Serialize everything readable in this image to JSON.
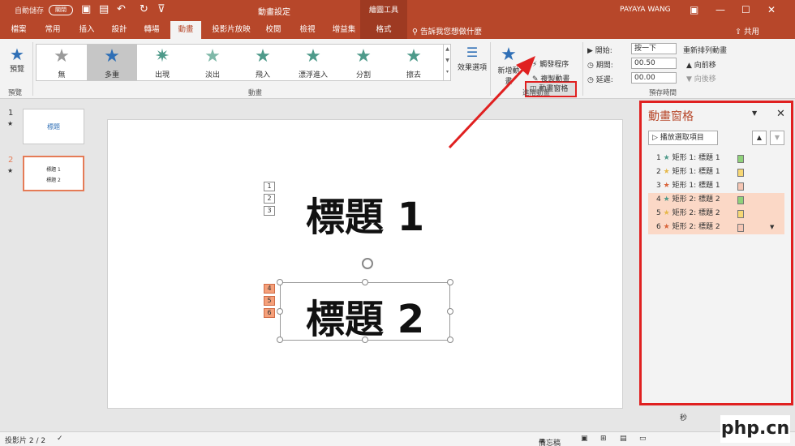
{
  "titlebar": {
    "autosave": "自動儲存",
    "autosave_state": "關閉",
    "doc_title": "動畫設定",
    "context_tools": "繪圖工具",
    "user": "PAYAYA WANG"
  },
  "tabs": [
    {
      "label": "檔案"
    },
    {
      "label": "常用"
    },
    {
      "label": "插入"
    },
    {
      "label": "設計"
    },
    {
      "label": "轉場"
    },
    {
      "label": "動畫"
    },
    {
      "label": "投影片放映"
    },
    {
      "label": "校閱"
    },
    {
      "label": "檢視"
    },
    {
      "label": "增益集"
    },
    {
      "label": "格式"
    }
  ],
  "tell_me": "告訴我您想做什麼",
  "share": "共用",
  "ribbon": {
    "preview": "預覽",
    "preview_group": "預覽",
    "animations": [
      {
        "label": "無",
        "color": "#9a9a9a"
      },
      {
        "label": "多重",
        "color": "#2f6fb6"
      },
      {
        "label": "出現",
        "color": "#4e9a8a"
      },
      {
        "label": "淡出",
        "color": "#4e9a8a"
      },
      {
        "label": "飛入",
        "color": "#4e9a8a"
      },
      {
        "label": "漂浮進入",
        "color": "#4e9a8a"
      },
      {
        "label": "分割",
        "color": "#4e9a8a"
      },
      {
        "label": "擦去",
        "color": "#4e9a8a"
      }
    ],
    "animation_group": "動畫",
    "effect_options": "效果選項",
    "add_animation": "新增動畫",
    "animation_pane": "動畫窗格",
    "trigger": "觸發程序",
    "animation_painter": "複製動畫",
    "advanced_group": "進階動畫",
    "start_label": "開始:",
    "start_value": "按一下",
    "duration_label": "期間:",
    "duration_value": "00.50",
    "delay_label": "延遲:",
    "delay_value": "00.00",
    "timing_group": "預存時間",
    "reorder_title": "重新排列動畫",
    "move_earlier": "向前移",
    "move_later": "向後移"
  },
  "slides": [
    {
      "num": "1",
      "title": "標題"
    },
    {
      "num": "2",
      "lines": [
        "標題 1",
        "標題 2"
      ]
    }
  ],
  "slide": {
    "title1": "標題 1",
    "title2": "標題 2",
    "tags": [
      "1",
      "2",
      "3",
      "4",
      "5",
      "6"
    ]
  },
  "pane": {
    "title": "動畫窗格",
    "play_button": "播放選取項目",
    "items": [
      {
        "num": "1",
        "label": "矩形 1: 標題 1",
        "star_color": "#4e9a8a",
        "swatch": "#8fd27a"
      },
      {
        "num": "2",
        "label": "矩形 1: 標題 1",
        "star_color": "#e6b84a",
        "swatch": "#f7d774"
      },
      {
        "num": "3",
        "label": "矩形 1: 標題 1",
        "star_color": "#d9643a",
        "swatch": "#f5c6b4"
      },
      {
        "num": "4",
        "label": "矩形 2: 標題 2",
        "star_color": "#4e9a8a",
        "swatch": "#8fd27a"
      },
      {
        "num": "5",
        "label": "矩形 2: 標題 2",
        "star_color": "#e6b84a",
        "swatch": "#f7d774"
      },
      {
        "num": "6",
        "label": "矩形 2: 標題 2",
        "star_color": "#d9643a",
        "swatch": "#f5c6b4"
      }
    ],
    "footer": "秒"
  },
  "status": {
    "slide_info": "投影片 2 / 2",
    "notes": "備忘稿"
  },
  "watermark": "php.cn",
  "colors": {
    "accent": "#b7472a",
    "highlight": "#e02020",
    "selected_tag": "#f5a07a"
  }
}
